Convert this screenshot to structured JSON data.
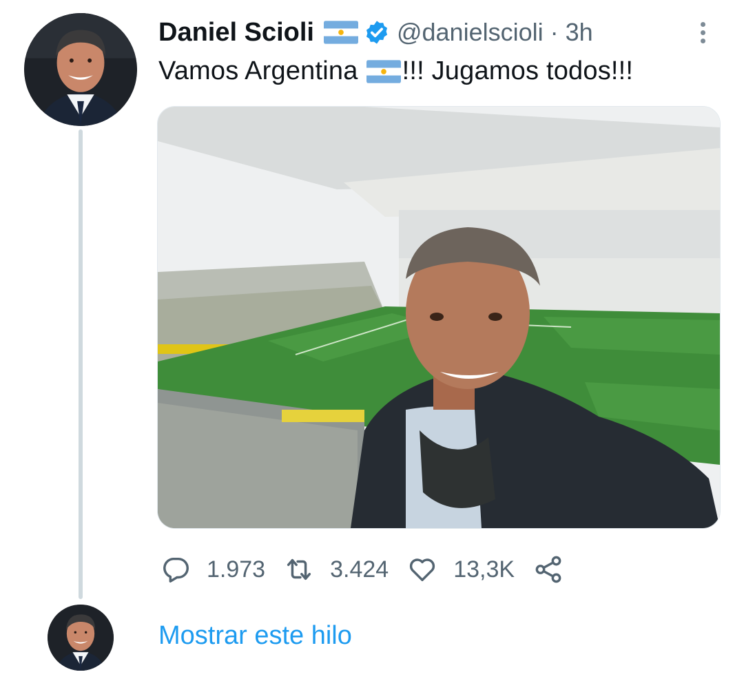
{
  "tweet": {
    "author_name": "Daniel Scioli",
    "author_handle": "@danielscioli",
    "separator": "·",
    "time": "3h",
    "text_before_flag": "Vamos Argentina",
    "text_after_flag": "!!! Jugamos todos!!!",
    "flag_icon": "argentina-flag-emoji",
    "verified_icon": "verified-badge-icon",
    "accent_color": "#1d9bf0"
  },
  "metrics": {
    "replies": "1.973",
    "retweets": "3.424",
    "likes": "13,3K"
  },
  "thread": {
    "show_thread_label": "Mostrar este hilo"
  }
}
